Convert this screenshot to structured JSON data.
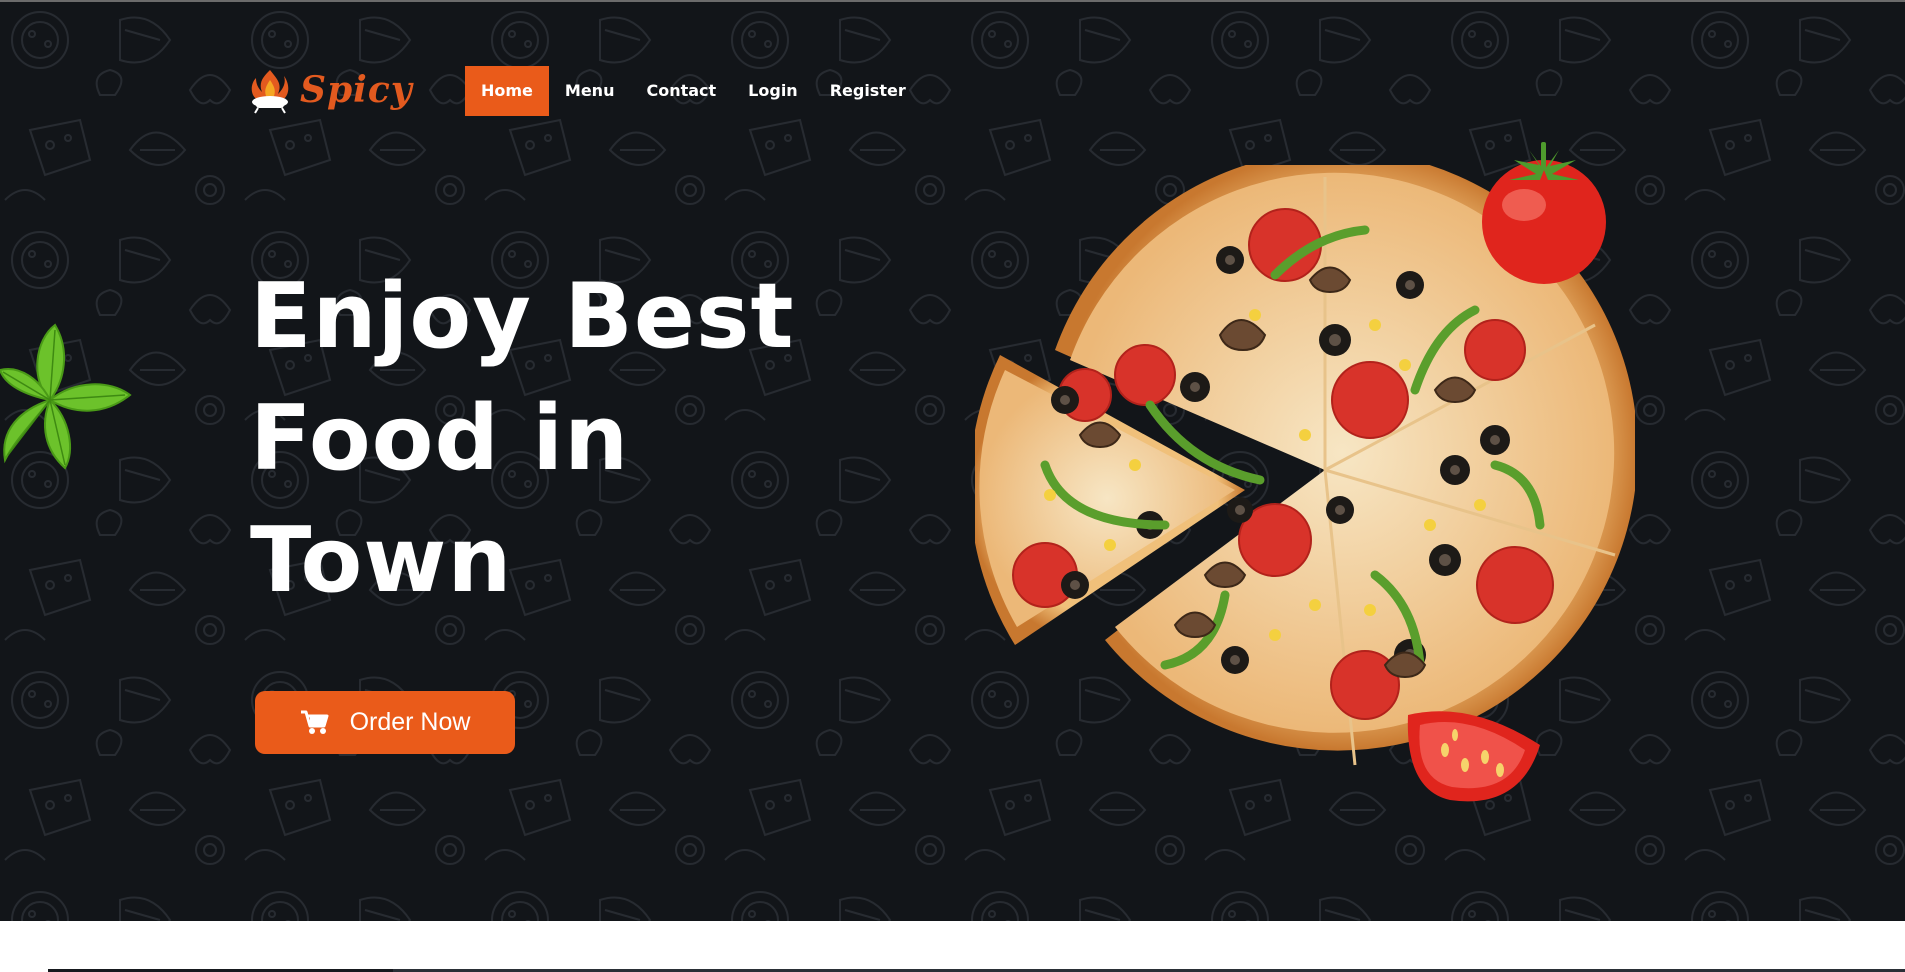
{
  "brand": {
    "name": "Spicy",
    "logo_icon": "flame-pot-icon",
    "accent_color": "#ea5b1a"
  },
  "nav": {
    "items": [
      {
        "label": "Home",
        "active": true
      },
      {
        "label": "Menu",
        "active": false
      },
      {
        "label": "Contact",
        "active": false
      },
      {
        "label": "Login",
        "active": false
      },
      {
        "label": "Register",
        "active": false
      }
    ]
  },
  "hero": {
    "headline_lines": [
      "Enjoy Best",
      "Food in",
      "Town"
    ],
    "cta": {
      "label": "Order Now",
      "icon": "cart-icon"
    },
    "background_color": "#121519"
  },
  "images": {
    "pizza": "pizza-image",
    "tomato": "tomato-image",
    "tomato_slice": "tomato-slice-image",
    "leaf": "leaf-image"
  }
}
